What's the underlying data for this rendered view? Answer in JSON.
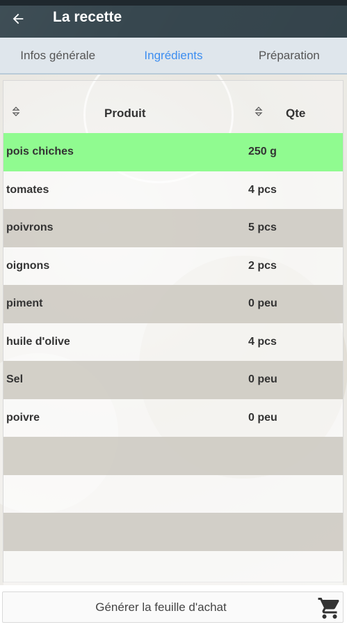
{
  "appbar": {
    "title": "La recette",
    "back_icon": "arrow-left-icon"
  },
  "tabs": [
    {
      "label": "Infos générale",
      "active": false
    },
    {
      "label": "Ingrédients",
      "active": true
    },
    {
      "label": "Préparation",
      "active": false
    }
  ],
  "table": {
    "headers": {
      "product": "Produit",
      "qty": "Qte"
    },
    "rows": [
      {
        "name": "pois chiches",
        "qty": "250 g",
        "selected": true
      },
      {
        "name": "tomates",
        "qty": "4 pcs",
        "selected": false
      },
      {
        "name": "poivrons",
        "qty": "5 pcs",
        "selected": false
      },
      {
        "name": "oignons",
        "qty": "2 pcs",
        "selected": false
      },
      {
        "name": "piment",
        "qty": "0 peu",
        "selected": false
      },
      {
        "name": "huile d'olive",
        "qty": "4 pcs",
        "selected": false
      },
      {
        "name": "Sel",
        "qty": "0 peu",
        "selected": false
      },
      {
        "name": "poivre",
        "qty": "0 peu",
        "selected": false
      },
      {
        "name": "",
        "qty": "",
        "selected": false
      },
      {
        "name": "",
        "qty": "",
        "selected": false
      },
      {
        "name": "",
        "qty": "",
        "selected": false
      },
      {
        "name": "",
        "qty": "",
        "selected": false
      }
    ]
  },
  "footer": {
    "generate_label": "Générer la feuille d'achat",
    "cart_icon": "shopping-cart-icon"
  },
  "colors": {
    "appbar": "#37474f",
    "tab_active": "#3d8ef0",
    "selected_row": "#90fb90",
    "stripe_row": "#cfccc4"
  }
}
